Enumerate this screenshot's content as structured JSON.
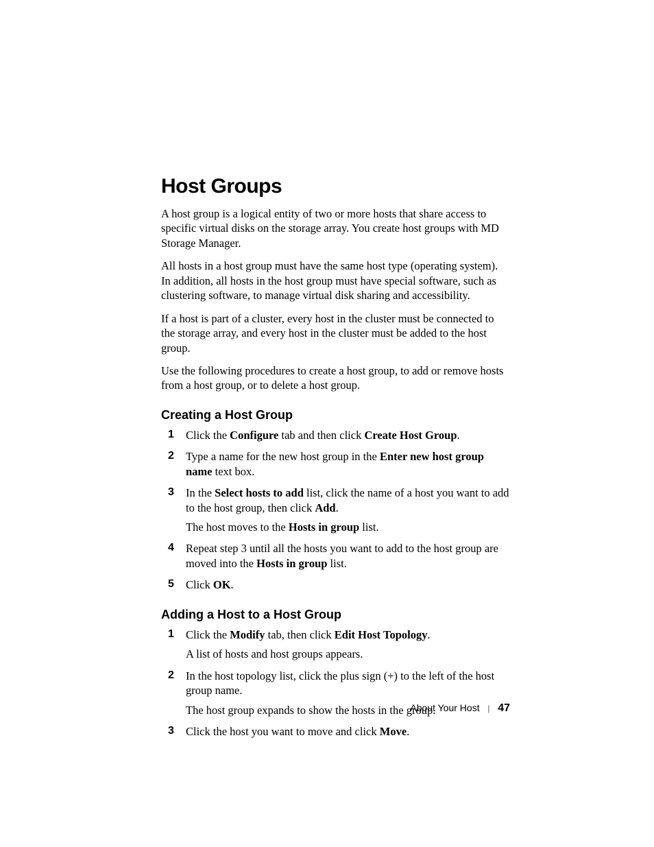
{
  "title": "Host Groups",
  "paras": [
    "A host group is a logical entity of two or more hosts that share access to specific virtual disks on the storage array. You create host groups with MD Storage Manager.",
    "All hosts in a host group must have the same host type (operating system). In addition, all hosts in the host group must have special software, such as clustering software, to manage virtual disk sharing and accessibility.",
    "If a host is part of a cluster, every host in the cluster must be connected to the storage array, and every host in the cluster must be added to the host group.",
    "Use the following procedures to create a host group, to add or remove hosts from a host group, or to delete a host group."
  ],
  "sec1": {
    "title": "Creating a Host Group",
    "s1a": "Click the ",
    "s1b": "Configure",
    "s1c": " tab and then click ",
    "s1d": "Create Host Group",
    "s1e": ".",
    "s2a": "Type a name for the new host group in the ",
    "s2b": "Enter new host group name",
    "s2c": " text box.",
    "s3a": "In the ",
    "s3b": "Select hosts to add",
    "s3c": " list, click the name of a host you want to add to the host group, then click ",
    "s3d": "Add",
    "s3e": ".",
    "s3n1": "The host moves to the ",
    "s3n2": "Hosts in group",
    "s3n3": " list.",
    "s4a": "Repeat step 3 until all the hosts you want to add to the host group are moved into the ",
    "s4b": "Hosts in group",
    "s4c": " list.",
    "s5a": "Click ",
    "s5b": "OK",
    "s5c": "."
  },
  "sec2": {
    "title": "Adding a Host to a Host Group",
    "s1a": "Click the ",
    "s1b": "Modify",
    "s1c": " tab, then click ",
    "s1d": "Edit Host Topology",
    "s1e": ".",
    "s1n": "A list of hosts and host groups appears.",
    "s2a": "In the host topology list, click the plus sign (+) to the left of the host group name.",
    "s2n": "The host group expands to show the hosts in the group.",
    "s3a": "Click the host you want to move and click ",
    "s3b": "Move",
    "s3c": "."
  },
  "footer": {
    "section": "About Your Host",
    "page": "47"
  }
}
